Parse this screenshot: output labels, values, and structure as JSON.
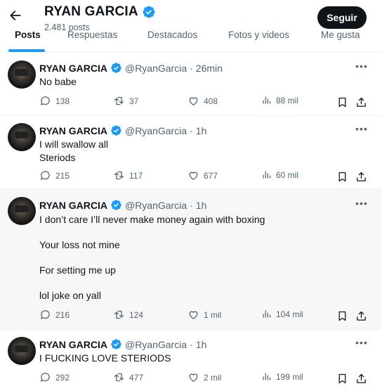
{
  "header": {
    "title": "RYAN GARCIA",
    "posts_count": "2.481 posts",
    "follow_label": "Seguir"
  },
  "tabs": [
    {
      "label": "Posts",
      "active": true
    },
    {
      "label": "Respuestas",
      "active": false
    },
    {
      "label": "Destacados",
      "active": false
    },
    {
      "label": "Fotos y videos",
      "active": false
    },
    {
      "label": "Me gusta",
      "active": false
    }
  ],
  "posts": [
    {
      "name": "RYAN GARCIA",
      "handle": "@RyanGarcia",
      "dot": "·",
      "time": "26min",
      "lines": [
        "No babe"
      ],
      "replies": "138",
      "reposts": "37",
      "likes": "408",
      "views": "88 mil"
    },
    {
      "name": "RYAN GARCIA",
      "handle": "@RyanGarcia",
      "dot": "·",
      "time": "1h",
      "lines": [
        "I will swallow all",
        "Steriods"
      ],
      "replies": "215",
      "reposts": "117",
      "likes": "677",
      "views": "60 mil"
    },
    {
      "name": "RYAN GARCIA",
      "handle": "@RyanGarcia",
      "dot": "·",
      "time": "1h",
      "lines": [
        "I don’t care I’ll never make money again with boxing",
        "Your loss not mine",
        "For setting me up",
        "lol joke on yall"
      ],
      "replies": "216",
      "reposts": "124",
      "likes": "1 mil",
      "views": "104 mil"
    },
    {
      "name": "RYAN GARCIA",
      "handle": "@RyanGarcia",
      "dot": "·",
      "time": "1h",
      "lines": [
        "I FUCKING LOVE STERIODS"
      ],
      "replies": "292",
      "reposts": "477",
      "likes": "2 mil",
      "views": "199 mil"
    }
  ],
  "colors": {
    "accent": "#1d9bf0",
    "text": "#0f1419",
    "secondary": "#536471",
    "verified": "#1d9bf0"
  },
  "icons": [
    "back-arrow-icon",
    "verified-badge-icon",
    "more-icon",
    "reply-icon",
    "repost-icon",
    "like-icon",
    "views-icon",
    "bookmark-icon",
    "share-icon"
  ]
}
